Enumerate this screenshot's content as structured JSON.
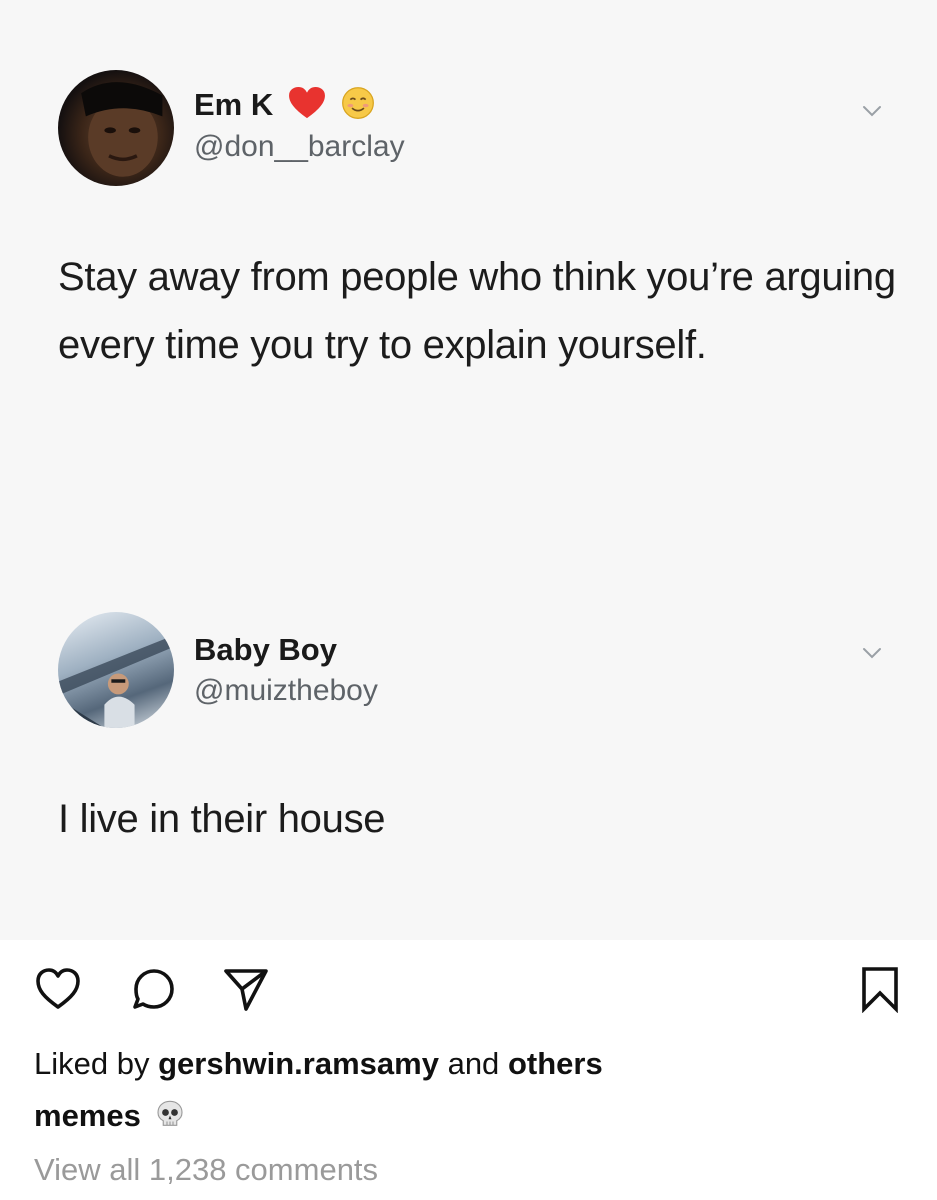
{
  "post_image": {
    "tweets": [
      {
        "display_name": "Em K",
        "name_emojis": [
          "red-heart-icon",
          "smiling-blush-face-icon"
        ],
        "handle": "@don__barclay",
        "text": "Stay away from people who think you’re arguing every time you try to explain yourself."
      },
      {
        "display_name": "Baby Boy",
        "handle": "@muiztheboy",
        "text": "I live in their house"
      }
    ]
  },
  "actions": {
    "icons": [
      "heart-icon",
      "comment-bubble-icon",
      "send-icon",
      "bookmark-icon"
    ]
  },
  "likes": {
    "prefix": "Liked by",
    "user": "gershwin.ramsamy",
    "middle": "and",
    "others": "others"
  },
  "caption": {
    "username": "memes",
    "emoji": "skull-icon"
  },
  "comments": {
    "view_all_label": "View all 1,238 comments"
  },
  "colors": {
    "heart_red": "#e8332f",
    "handle_gray": "#5e6368",
    "muted_gray": "#9a9a9a"
  }
}
